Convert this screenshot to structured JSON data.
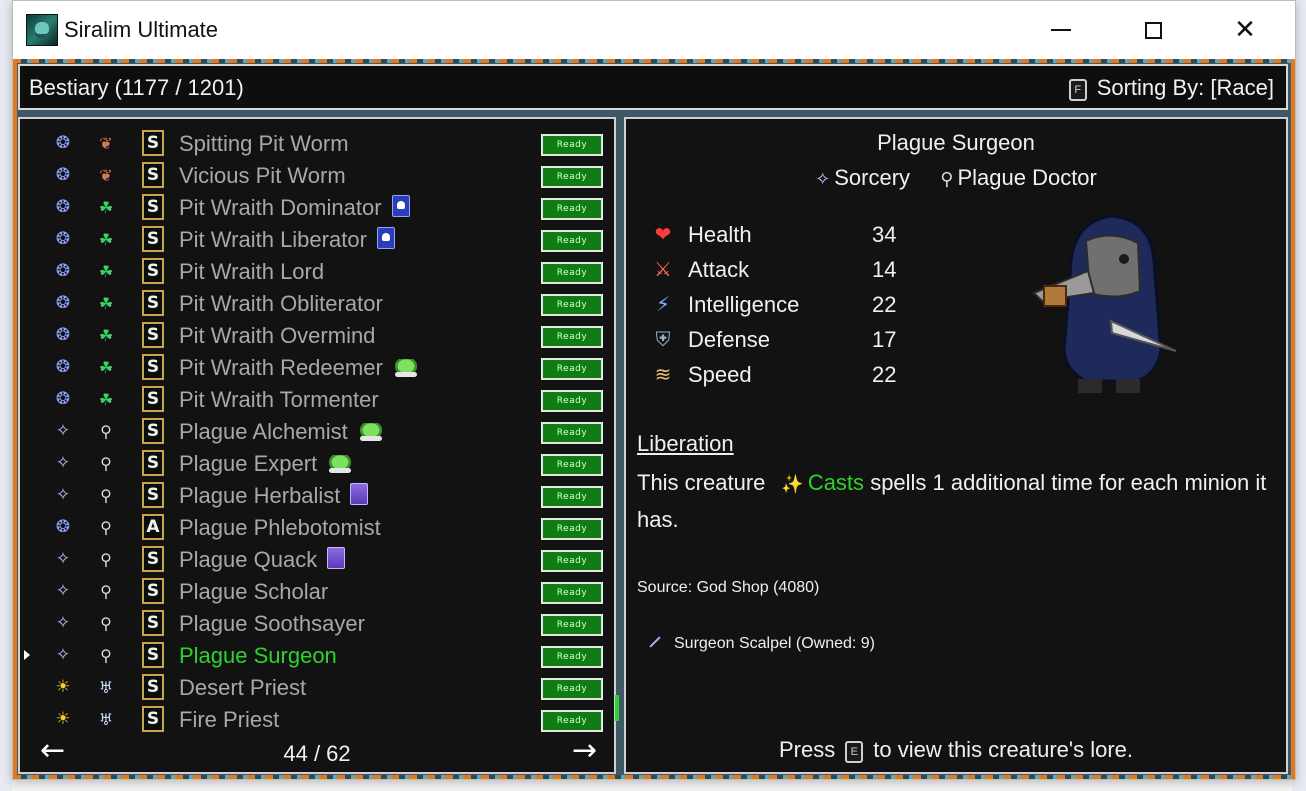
{
  "window": {
    "title": "Siralim Ultimate",
    "minimize_icon": "minimize-icon",
    "maximize_icon": "maximize-icon",
    "close_icon": "close-icon"
  },
  "header": {
    "title": "Bestiary (1177 / 1201)",
    "sort_key": "F",
    "sort_label": "Sorting By: [Race]"
  },
  "list": {
    "rows": [
      {
        "class_icon": "nature-class-icon",
        "class_color": "#8fa3ff",
        "class_glyph": "❂",
        "race_icon": "pit-worm-race-icon",
        "race_color": "#d8755c",
        "race_glyph": "❦",
        "card": "S",
        "name": "Spitting Pit Worm",
        "badge": "",
        "status": "Ready",
        "selected": false
      },
      {
        "class_icon": "nature-class-icon",
        "class_color": "#8fa3ff",
        "class_glyph": "❂",
        "race_icon": "pit-worm-race-icon",
        "race_color": "#d8755c",
        "race_glyph": "❦",
        "card": "S",
        "name": "Vicious Pit Worm",
        "badge": "",
        "status": "Ready",
        "selected": false
      },
      {
        "class_icon": "nature-class-icon",
        "class_color": "#8fa3ff",
        "class_glyph": "❂",
        "race_icon": "pit-wraith-race-icon",
        "race_color": "#3fd06a",
        "race_glyph": "☘",
        "card": "S",
        "name": "Pit Wraith Dominator",
        "badge": "skull",
        "status": "Ready",
        "selected": false
      },
      {
        "class_icon": "nature-class-icon",
        "class_color": "#8fa3ff",
        "class_glyph": "❂",
        "race_icon": "pit-wraith-race-icon",
        "race_color": "#3fd06a",
        "race_glyph": "☘",
        "card": "S",
        "name": "Pit Wraith Liberator",
        "badge": "skull",
        "status": "Ready",
        "selected": false
      },
      {
        "class_icon": "nature-class-icon",
        "class_color": "#8fa3ff",
        "class_glyph": "❂",
        "race_icon": "pit-wraith-race-icon",
        "race_color": "#3fd06a",
        "race_glyph": "☘",
        "card": "S",
        "name": "Pit Wraith Lord",
        "badge": "",
        "status": "Ready",
        "selected": false
      },
      {
        "class_icon": "nature-class-icon",
        "class_color": "#8fa3ff",
        "class_glyph": "❂",
        "race_icon": "pit-wraith-race-icon",
        "race_color": "#3fd06a",
        "race_glyph": "☘",
        "card": "S",
        "name": "Pit Wraith Obliterator",
        "badge": "",
        "status": "Ready",
        "selected": false
      },
      {
        "class_icon": "nature-class-icon",
        "class_color": "#8fa3ff",
        "class_glyph": "❂",
        "race_icon": "pit-wraith-race-icon",
        "race_color": "#3fd06a",
        "race_glyph": "☘",
        "card": "S",
        "name": "Pit Wraith Overmind",
        "badge": "",
        "status": "Ready",
        "selected": false
      },
      {
        "class_icon": "nature-class-icon",
        "class_color": "#8fa3ff",
        "class_glyph": "❂",
        "race_icon": "pit-wraith-race-icon",
        "race_color": "#3fd06a",
        "race_glyph": "☘",
        "card": "S",
        "name": "Pit Wraith Redeemer",
        "badge": "slime",
        "status": "Ready",
        "selected": false
      },
      {
        "class_icon": "nature-class-icon",
        "class_color": "#8fa3ff",
        "class_glyph": "❂",
        "race_icon": "pit-wraith-race-icon",
        "race_color": "#3fd06a",
        "race_glyph": "☘",
        "card": "S",
        "name": "Pit Wraith Tormenter",
        "badge": "",
        "status": "Ready",
        "selected": false
      },
      {
        "class_icon": "sorcery-class-icon",
        "class_color": "#c9b8ff",
        "class_glyph": "✧",
        "race_icon": "plague-doctor-race-icon",
        "race_color": "#d8d8d8",
        "race_glyph": "⚲",
        "card": "S",
        "name": "Plague Alchemist",
        "badge": "slime",
        "status": "Ready",
        "selected": false
      },
      {
        "class_icon": "sorcery-class-icon",
        "class_color": "#c9b8ff",
        "class_glyph": "✧",
        "race_icon": "plague-doctor-race-icon",
        "race_color": "#d8d8d8",
        "race_glyph": "⚲",
        "card": "S",
        "name": "Plague Expert",
        "badge": "slime",
        "status": "Ready",
        "selected": false
      },
      {
        "class_icon": "sorcery-class-icon",
        "class_color": "#c9b8ff",
        "class_glyph": "✧",
        "race_icon": "plague-doctor-race-icon",
        "race_color": "#d8d8d8",
        "race_glyph": "⚲",
        "card": "S",
        "name": "Plague Herbalist",
        "badge": "purple",
        "status": "Ready",
        "selected": false
      },
      {
        "class_icon": "nature-class-icon",
        "class_color": "#8fa3ff",
        "class_glyph": "❂",
        "race_icon": "plague-doctor-race-icon",
        "race_color": "#d8d8d8",
        "race_glyph": "⚲",
        "card": "A",
        "name": "Plague Phlebotomist",
        "badge": "",
        "status": "Ready",
        "selected": false
      },
      {
        "class_icon": "sorcery-class-icon",
        "class_color": "#c9b8ff",
        "class_glyph": "✧",
        "race_icon": "plague-doctor-race-icon",
        "race_color": "#d8d8d8",
        "race_glyph": "⚲",
        "card": "S",
        "name": "Plague Quack",
        "badge": "purple",
        "status": "Ready",
        "selected": false
      },
      {
        "class_icon": "sorcery-class-icon",
        "class_color": "#c9b8ff",
        "class_glyph": "✧",
        "race_icon": "plague-doctor-race-icon",
        "race_color": "#d8d8d8",
        "race_glyph": "⚲",
        "card": "S",
        "name": "Plague Scholar",
        "badge": "",
        "status": "Ready",
        "selected": false
      },
      {
        "class_icon": "sorcery-class-icon",
        "class_color": "#c9b8ff",
        "class_glyph": "✧",
        "race_icon": "plague-doctor-race-icon",
        "race_color": "#d8d8d8",
        "race_glyph": "⚲",
        "card": "S",
        "name": "Plague Soothsayer",
        "badge": "",
        "status": "Ready",
        "selected": false
      },
      {
        "class_icon": "sorcery-class-icon",
        "class_color": "#c9b8ff",
        "class_glyph": "✧",
        "race_icon": "plague-doctor-race-icon",
        "race_color": "#d8d8d8",
        "race_glyph": "⚲",
        "card": "S",
        "name": "Plague Surgeon",
        "badge": "",
        "status": "Ready",
        "selected": true
      },
      {
        "class_icon": "life-class-icon",
        "class_color": "#ffcc33",
        "class_glyph": "☀",
        "race_icon": "priest-race-icon",
        "race_color": "#c8d8ff",
        "race_glyph": "♅",
        "card": "S",
        "name": "Desert Priest",
        "badge": "",
        "status": "Ready",
        "selected": false
      },
      {
        "class_icon": "life-class-icon",
        "class_color": "#ffcc33",
        "class_glyph": "☀",
        "race_icon": "priest-race-icon",
        "race_color": "#c8d8ff",
        "race_glyph": "♅",
        "card": "S",
        "name": "Fire Priest",
        "badge": "",
        "status": "Ready",
        "selected": false
      }
    ],
    "prev_icon": "arrow-left-icon",
    "next_icon": "arrow-right-icon",
    "page": "44 / 62"
  },
  "detail": {
    "name": "Plague Surgeon",
    "class_name": "Sorcery",
    "class_icon": "sorcery-icon",
    "race_name": "Plague Doctor",
    "race_icon": "plague-doctor-icon",
    "stats": [
      {
        "icon": "heart-icon",
        "glyph": "❤",
        "color": "#ff3b3b",
        "label": "Health",
        "value": "34"
      },
      {
        "icon": "sword-icon",
        "glyph": "⚔",
        "color": "#ff6a5a",
        "label": "Attack",
        "value": "14"
      },
      {
        "icon": "lightning-icon",
        "glyph": "⚡",
        "color": "#7fb0ff",
        "label": "Intelligence",
        "value": "22"
      },
      {
        "icon": "shield-icon",
        "glyph": "⛨",
        "color": "#9ab0c8",
        "label": "Defense",
        "value": "17"
      },
      {
        "icon": "wing-icon",
        "glyph": "≋",
        "color": "#f0c070",
        "label": "Speed",
        "value": "22"
      }
    ],
    "perk_title": "Liberation",
    "perk_text_before": "This creature",
    "perk_keyword": "Casts",
    "perk_text_after": "spells 1 additional time for each minion it has.",
    "source": "Source: God Shop (4080)",
    "artifact": "Surgeon Scalpel (Owned: 9)",
    "lore_press": "Press",
    "lore_key": "E",
    "lore_after": "to view this creature's lore."
  }
}
